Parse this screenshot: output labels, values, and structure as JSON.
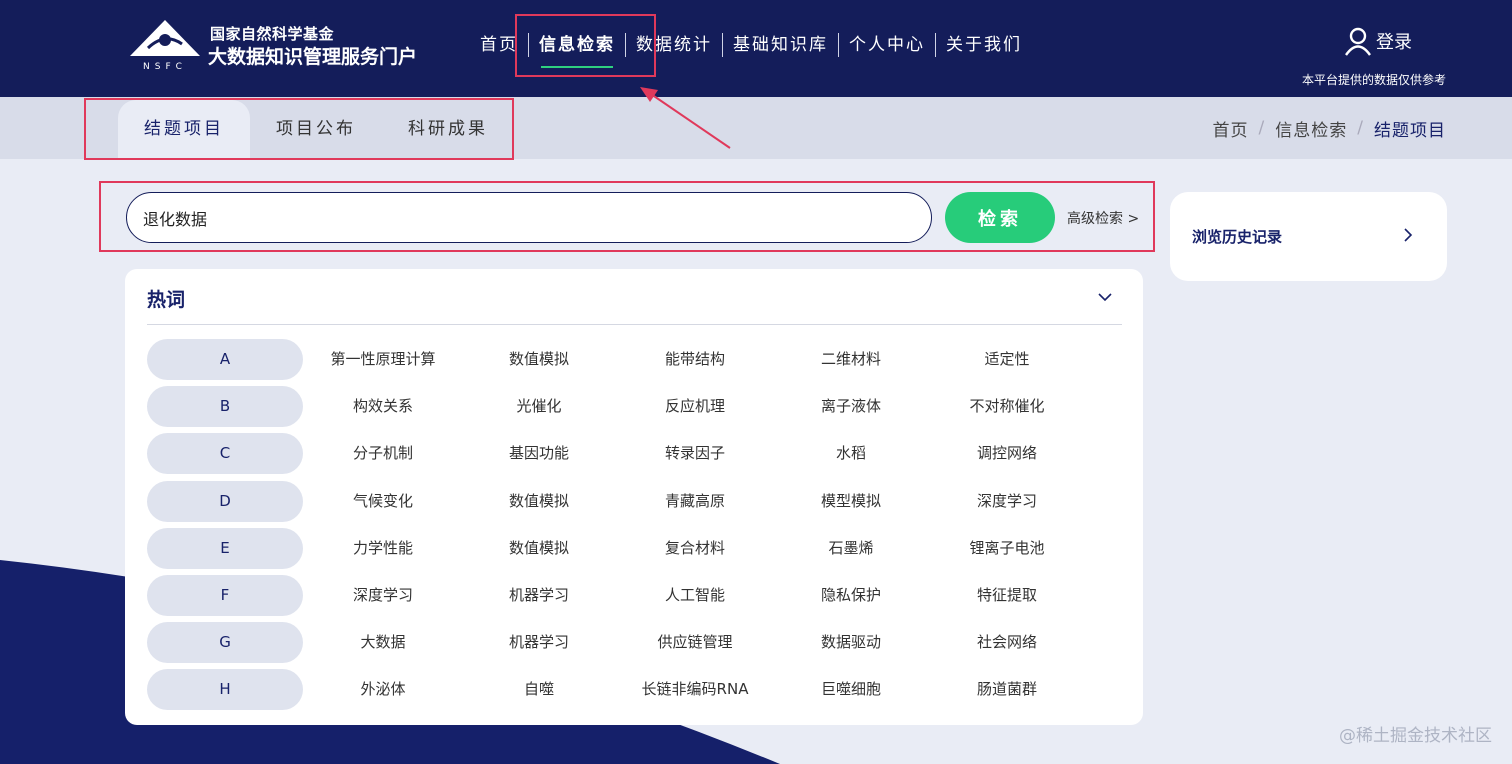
{
  "header": {
    "logo_line1": "国家自然科学基金",
    "logo_line2": "大数据知识管理服务门户",
    "logo_abbr": "NSFC",
    "nav": [
      {
        "label": "首页",
        "active": false
      },
      {
        "label": "信息检索",
        "active": true
      },
      {
        "label": "数据统计",
        "active": false
      },
      {
        "label": "基础知识库",
        "active": false
      },
      {
        "label": "个人中心",
        "active": false
      },
      {
        "label": "关于我们",
        "active": false
      }
    ],
    "login_label": "登录",
    "notice": "本平台提供的数据仅供参考"
  },
  "subnav": {
    "tabs": [
      {
        "label": "结题项目",
        "active": true
      },
      {
        "label": "项目公布",
        "active": false
      },
      {
        "label": "科研成果",
        "active": false
      }
    ],
    "breadcrumb": [
      "首页",
      "信息检索",
      "结题项目"
    ]
  },
  "search": {
    "value": "退化数据",
    "button_label": "检索",
    "advanced_label": "高级检索 >"
  },
  "history": {
    "label": "浏览历史记录"
  },
  "hot_words": {
    "title": "热词",
    "rows": [
      {
        "letter": "A",
        "words": [
          "第一性原理计算",
          "数值模拟",
          "能带结构",
          "二维材料",
          "适定性"
        ]
      },
      {
        "letter": "B",
        "words": [
          "构效关系",
          "光催化",
          "反应机理",
          "离子液体",
          "不对称催化"
        ]
      },
      {
        "letter": "C",
        "words": [
          "分子机制",
          "基因功能",
          "转录因子",
          "水稻",
          "调控网络"
        ]
      },
      {
        "letter": "D",
        "words": [
          "气候变化",
          "数值模拟",
          "青藏高原",
          "模型模拟",
          "深度学习"
        ]
      },
      {
        "letter": "E",
        "words": [
          "力学性能",
          "数值模拟",
          "复合材料",
          "石墨烯",
          "锂离子电池"
        ]
      },
      {
        "letter": "F",
        "words": [
          "深度学习",
          "机器学习",
          "人工智能",
          "隐私保护",
          "特征提取"
        ]
      },
      {
        "letter": "G",
        "words": [
          "大数据",
          "机器学习",
          "供应链管理",
          "数据驱动",
          "社会网络"
        ]
      },
      {
        "letter": "H",
        "words": [
          "外泌体",
          "自噬",
          "长链非编码RNA",
          "巨噬细胞",
          "肠道菌群"
        ]
      }
    ]
  },
  "watermark": "@稀土掘金技术社区",
  "colors": {
    "header_bg": "#141d5a",
    "accent_green": "#27cc7a",
    "annotation_red": "#e0395b",
    "brand_navy": "#18226a"
  }
}
